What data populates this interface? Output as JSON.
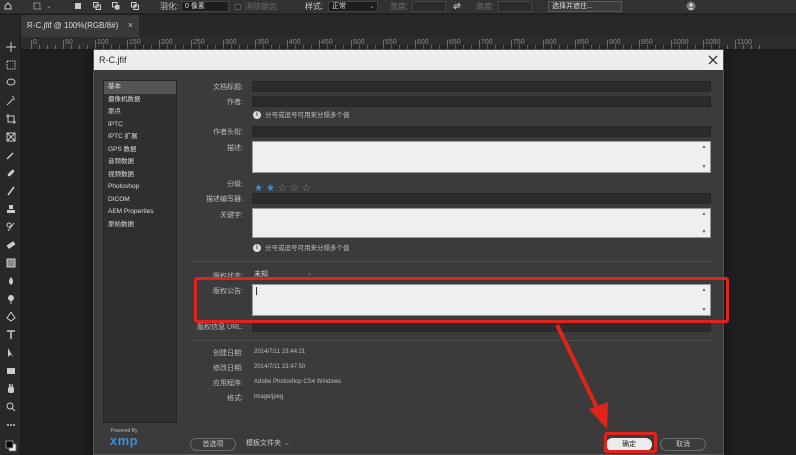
{
  "options_bar": {
    "feather_label": "羽化:",
    "feather_value": "0 像素",
    "antialias_label": "消除锯齿",
    "style_label": "样式:",
    "style_value": "正常",
    "width_label": "宽度:",
    "height_label": "高度:",
    "select_mask_button": "选择并遮住..."
  },
  "document": {
    "tab_title": "R-C.jfif @ 100%(RGB/8#)",
    "ruler_ticks": [
      "0",
      "50",
      "100",
      "150",
      "200",
      "250",
      "300",
      "350",
      "400",
      "450",
      "500",
      "550",
      "600",
      "650",
      "700",
      "750",
      "800",
      "850",
      "900",
      "950",
      "1000",
      "1050",
      "1100"
    ]
  },
  "dialog": {
    "title": "R-C.jfif",
    "categories": [
      "基本",
      "摄像机数据",
      "原点",
      "IPTC",
      "IPTC 扩展",
      "GPS 数据",
      "音频数据",
      "视频数据",
      "Photoshop",
      "DICOM",
      "AEM Properties",
      "原始数据"
    ],
    "selected_category": "基本",
    "fields": {
      "doc_title_label": "文档标题:",
      "author_label": "作者:",
      "author_hint": "分号或逗号可用来分隔多个值",
      "author_title_label": "作者头衔:",
      "description_label": "描述:",
      "rating_label": "分级:",
      "rating_value": 2,
      "rating_max": 5,
      "desc_writer_label": "描述编写器:",
      "keywords_label": "关键字:",
      "keywords_hint": "分号或逗号可用来分隔多个值",
      "copyright_status_label": "版权状态:",
      "copyright_status_value": "未知",
      "copyright_notice_label": "版权公告:",
      "copyright_notice_value": "",
      "copyright_url_label": "版权信息 URL:"
    },
    "metadata": {
      "created_label": "创建日期:",
      "created_value": "2014/7/11 23:44:21",
      "modified_label": "修改日期:",
      "modified_value": "2014/7/11 23:47:50",
      "app_label": "应用程序:",
      "app_value": "Adobe Photoshop CS4 Windows",
      "format_label": "格式:",
      "format_value": "image/jpeg"
    },
    "footer": {
      "powered_by": "Powered By",
      "xmp_logo": "xmp",
      "preferences_button": "首选项",
      "template_folder_button": "模板文件夹",
      "ok_button": "确定",
      "cancel_button": "取消"
    }
  },
  "colors": {
    "annotation_red": "#e0241b",
    "star_active": "#3d8fd8"
  }
}
